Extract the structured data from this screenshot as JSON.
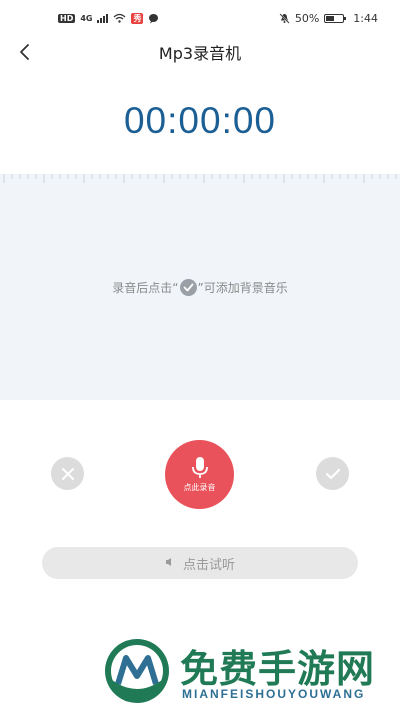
{
  "status_bar": {
    "left_badges": [
      "HD",
      "4G"
    ],
    "notification_badge": "秀",
    "battery": "50%",
    "battery_level": 0.5,
    "time": "1:44"
  },
  "title_bar": {
    "back_icon": "chevron-left-icon",
    "title": "Mp3录音机"
  },
  "timer": "00:00:00",
  "wave_panel": {
    "hint_before": "录音后点击“",
    "hint_icon": "check-circle-icon",
    "hint_after": "”可添加背景音乐"
  },
  "controls": {
    "cancel_icon": "close-icon",
    "record_icon": "microphone-icon",
    "record_label": "点此录音",
    "confirm_icon": "check-icon"
  },
  "listen_button": {
    "label": "点击试听"
  },
  "watermark": {
    "title": "免费手游网",
    "subtitle": "MIANFEISHOUYOUWANG"
  },
  "colors": {
    "timer": "#1c5f95",
    "record_button": "#e9525a",
    "panel_bg": "#f1f5f9",
    "watermark_title": "#1f7a55",
    "watermark_sub": "#2e6f93"
  }
}
